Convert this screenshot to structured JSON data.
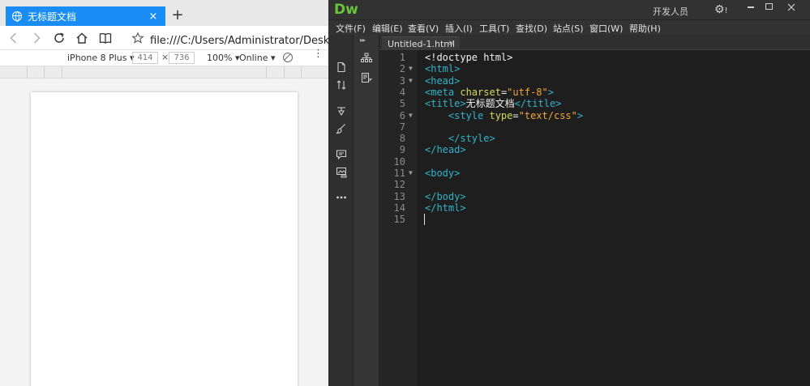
{
  "browser": {
    "tab_title": "无标题文档",
    "tab_close": "×",
    "new_tab": "+",
    "address": "file:///C:/Users/Administrator/Desktop/新建",
    "device": "iPhone 8 Plus ▾",
    "width": "414",
    "times": "×",
    "height": "736",
    "zoom": "100% ▾",
    "network": "Online ▾",
    "more": "⋮"
  },
  "dw": {
    "logo": "Dw",
    "workspace": "开发人员",
    "workspace_caret": "▾",
    "gear": "⚙",
    "gear_badge": "!",
    "menus": [
      "文件(F)",
      "编辑(E)",
      "查看(V)",
      "插入(I)",
      "工具(T)",
      "查找(D)",
      "站点(S)",
      "窗口(W)",
      "帮助(H)"
    ],
    "collapse": "▸▸",
    "tab": {
      "label": "Untitled-1.html",
      "close": "×"
    },
    "fold_marker": "▼",
    "lines": [
      {
        "n": "1",
        "fold": false,
        "parts": [
          {
            "c": "tx",
            "t": "<!doctype html>"
          }
        ]
      },
      {
        "n": "2",
        "fold": true,
        "parts": [
          {
            "c": "tg",
            "t": "<html>"
          }
        ]
      },
      {
        "n": "3",
        "fold": true,
        "parts": [
          {
            "c": "tg",
            "t": "<head>"
          }
        ]
      },
      {
        "n": "4",
        "fold": false,
        "parts": [
          {
            "c": "tg",
            "t": "<meta "
          },
          {
            "c": "at",
            "t": "charset"
          },
          {
            "c": "tx",
            "t": "="
          },
          {
            "c": "st",
            "t": "\"utf-8\""
          },
          {
            "c": "tg",
            "t": ">"
          }
        ]
      },
      {
        "n": "5",
        "fold": false,
        "parts": [
          {
            "c": "tg",
            "t": "<title>"
          },
          {
            "c": "tx",
            "t": "无标题文档"
          },
          {
            "c": "tg",
            "t": "</title>"
          }
        ]
      },
      {
        "n": "6",
        "fold": true,
        "parts": [
          {
            "c": "tx",
            "t": "    "
          },
          {
            "c": "tg",
            "t": "<style "
          },
          {
            "c": "at",
            "t": "type"
          },
          {
            "c": "tx",
            "t": "="
          },
          {
            "c": "st",
            "t": "\"text/css\""
          },
          {
            "c": "tg",
            "t": ">"
          }
        ]
      },
      {
        "n": "7",
        "fold": false,
        "parts": []
      },
      {
        "n": "8",
        "fold": false,
        "parts": [
          {
            "c": "tx",
            "t": "    "
          },
          {
            "c": "tg",
            "t": "</style>"
          }
        ]
      },
      {
        "n": "9",
        "fold": false,
        "parts": [
          {
            "c": "tg",
            "t": "</head>"
          }
        ]
      },
      {
        "n": "10",
        "fold": false,
        "parts": []
      },
      {
        "n": "11",
        "fold": true,
        "parts": [
          {
            "c": "tg",
            "t": "<body>"
          }
        ]
      },
      {
        "n": "12",
        "fold": false,
        "parts": []
      },
      {
        "n": "13",
        "fold": false,
        "parts": [
          {
            "c": "tg",
            "t": "</body>"
          }
        ]
      },
      {
        "n": "14",
        "fold": false,
        "parts": [
          {
            "c": "tg",
            "t": "</html>"
          }
        ]
      },
      {
        "n": "15",
        "fold": false,
        "parts": []
      }
    ]
  },
  "colors": {
    "browser_tab": "#1a8df5",
    "dw_logo": "#67c43b",
    "code_tag": "#33b3c9",
    "code_attr": "#d8d860",
    "code_string": "#f2a53a",
    "editor_bg": "#1e1e1e"
  },
  "icons": [
    "globe-icon",
    "back-icon",
    "forward-icon",
    "reload-icon",
    "home-icon",
    "reading-view-icon",
    "favorite-star-icon",
    "rotate-icon",
    "more-icon",
    "file-icon",
    "sort-icon",
    "snippet-icon",
    "brush-icon",
    "comment-icon",
    "image-code-icon",
    "dom-tree-icon",
    "code-view-icon",
    "gear-icon"
  ]
}
